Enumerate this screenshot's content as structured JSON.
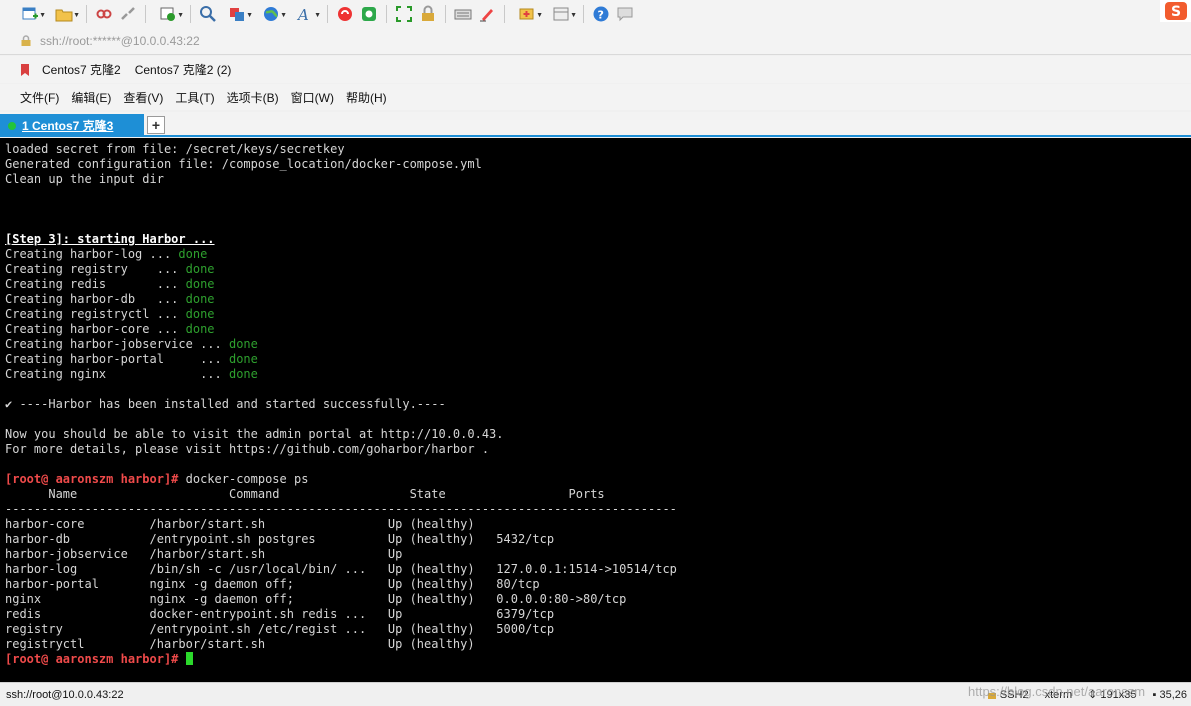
{
  "toolbar": {
    "icons": [
      "new-session-icon",
      "open-folder-icon",
      "disconnect-icon",
      "reconnect-icon",
      "session-properties-icon",
      "find-icon",
      "transfer-icon",
      "globe-icon",
      "font-icon",
      "xshell-icon",
      "xftp-icon",
      "fullscreen-icon",
      "lock-icon",
      "keyboard-icon",
      "highlight-icon",
      "compose-icon",
      "layout-icon",
      "help-icon",
      "chat-icon"
    ]
  },
  "address": {
    "value": "ssh://root:******@10.0.0.43:22"
  },
  "sessions": {
    "items": [
      "Centos7 克隆2",
      "Centos7 克隆2 (2)"
    ]
  },
  "menu": {
    "items": [
      "文件(F)",
      "编辑(E)",
      "查看(V)",
      "工具(T)",
      "选项卡(B)",
      "窗口(W)",
      "帮助(H)"
    ]
  },
  "tabs": {
    "active_label": "1 Centos7 克隆3",
    "add_label": "+"
  },
  "terminal": {
    "line1": "loaded secret from file: /secret/keys/secretkey",
    "line2": "Generated configuration file: /compose_location/docker-compose.yml",
    "line3": "Clean up the input dir",
    "step3": "[Step 3]: starting Harbor ...",
    "creating": [
      {
        "text": "Creating harbor-log ... ",
        "status": "done"
      },
      {
        "text": "Creating registry    ... ",
        "status": "done"
      },
      {
        "text": "Creating redis       ... ",
        "status": "done"
      },
      {
        "text": "Creating harbor-db   ... ",
        "status": "done"
      },
      {
        "text": "Creating registryctl ... ",
        "status": "done"
      },
      {
        "text": "Creating harbor-core ... ",
        "status": "done"
      },
      {
        "text": "Creating harbor-jobservice ... ",
        "status": "done"
      },
      {
        "text": "Creating harbor-portal     ... ",
        "status": "done"
      },
      {
        "text": "Creating nginx             ... ",
        "status": "done"
      }
    ],
    "success": "✔ ----Harbor has been installed and started successfully.----",
    "visit1": "Now you should be able to visit the admin portal at http://10.0.0.43.",
    "visit2": "For more details, please visit https://github.com/goharbor/harbor .",
    "prompt": "[root@ aaronszm harbor]#",
    "command": " docker-compose ps",
    "ps_header": "      Name                     Command                  State                 Ports",
    "ps_rule": "---------------------------------------------------------------------------------------------",
    "ps_rows": [
      "harbor-core         /harbor/start.sh                 Up (healthy)",
      "harbor-db           /entrypoint.sh postgres          Up (healthy)   5432/tcp",
      "harbor-jobservice   /harbor/start.sh                 Up",
      "harbor-log          /bin/sh -c /usr/local/bin/ ...   Up (healthy)   127.0.0.1:1514->10514/tcp",
      "harbor-portal       nginx -g daemon off;             Up (healthy)   80/tcp",
      "nginx               nginx -g daemon off;             Up (healthy)   0.0.0.0:80->80/tcp",
      "redis               docker-entrypoint.sh redis ...   Up             6379/tcp",
      "registry            /entrypoint.sh /etc/regist ...   Up (healthy)   5000/tcp",
      "registryctl         /harbor/start.sh                 Up (healthy)"
    ],
    "final_prompt": "[root@ aaronszm harbor]#"
  },
  "status": {
    "connection": "ssh://root@10.0.0.43:22",
    "protocol": "SSH2",
    "term": "xterm",
    "size": "191x35",
    "position": "35,26",
    "watermark": "https://blog.csdn.net/aaronszm"
  },
  "colors": {
    "tab_blue": "#1e8fd6",
    "done_green": "#2ea02e",
    "prompt_red": "#ef4a4a",
    "cursor_green": "#2bd92b"
  }
}
